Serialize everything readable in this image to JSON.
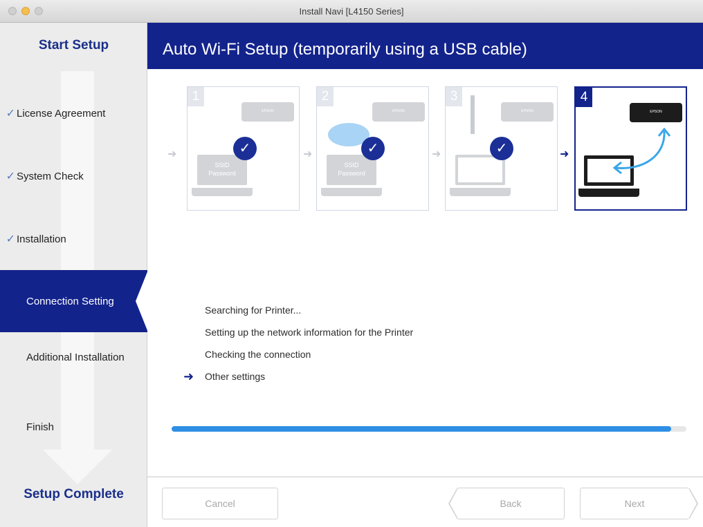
{
  "window": {
    "title": "Install Navi [L4150 Series]"
  },
  "sidebar": {
    "start_label": "Start Setup",
    "end_label": "Setup Complete",
    "steps": [
      {
        "label": "License Agreement",
        "done": true
      },
      {
        "label": "System Check",
        "done": true
      },
      {
        "label": "Installation",
        "done": true
      },
      {
        "label": "Connection Setting",
        "active": true
      },
      {
        "label": "Additional Installation"
      },
      {
        "label": "Finish"
      }
    ]
  },
  "header": {
    "title": "Auto Wi-Fi Setup (temporarily using a USB cable)"
  },
  "diagram": {
    "panels": [
      {
        "number": "1",
        "printer_label": "EPSON",
        "screen_line1": "SSID",
        "screen_line2": "Password"
      },
      {
        "number": "2",
        "printer_label": "EPSON",
        "screen_line1": "SSID",
        "screen_line2": "Password"
      },
      {
        "number": "3",
        "printer_label": "EPSON"
      },
      {
        "number": "4",
        "printer_label": "EPSON"
      }
    ],
    "check_glyph": "✓",
    "arrow_glyph": "➜"
  },
  "status_list": {
    "items": [
      "Searching for Printer...",
      "Setting up the network information for the Printer",
      "Checking the connection",
      "Other settings"
    ],
    "current_index": 3
  },
  "progress": {
    "fraction": 0.97
  },
  "footer": {
    "cancel_label": "Cancel",
    "back_label": "Back",
    "next_label": "Next"
  },
  "colors": {
    "brand": "#13238c",
    "progress": "#2e8fe5"
  }
}
